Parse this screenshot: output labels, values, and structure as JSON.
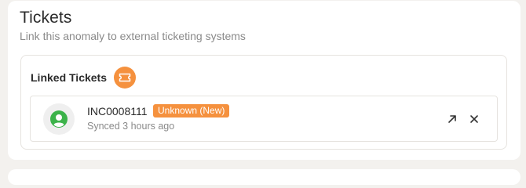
{
  "section": {
    "title": "Tickets",
    "subtitle": "Link this anomaly to external ticketing systems"
  },
  "linked_tickets": {
    "heading": "Linked Tickets",
    "icon": "ticket-icon",
    "accent_color": "#f5913e",
    "items": [
      {
        "id": "INC0008111",
        "status": "Unknown (New)",
        "synced": "Synced 3 hours ago",
        "avatar_icon": "user-icon",
        "avatar_color": "#3cb34a",
        "actions": [
          "open-external-icon",
          "close-icon"
        ]
      }
    ]
  }
}
